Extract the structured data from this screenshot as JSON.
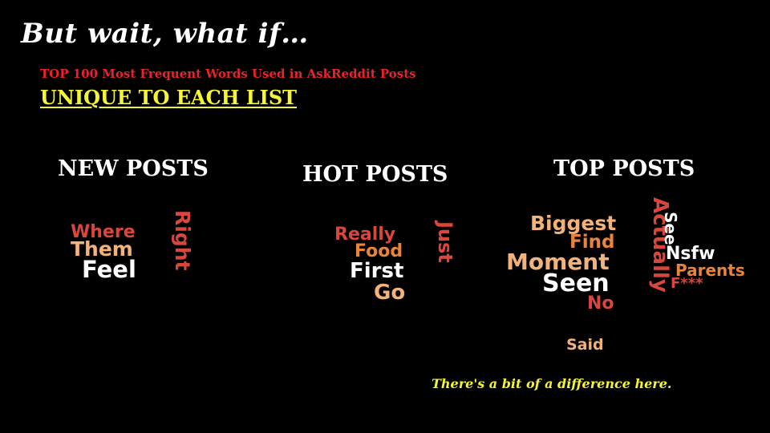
{
  "slide": {
    "title": "But wait, what if…",
    "subtitle": "TOP 100 Most Frequent Words Used in AskReddit Posts",
    "highlight": "UNIQUE TO EACH LIST",
    "caption": "There's a bit of a difference here."
  },
  "columns": {
    "new": {
      "heading": "NEW POSTS",
      "words": [
        "Where",
        "Them",
        "Feel",
        "Right"
      ]
    },
    "hot": {
      "heading": "HOT POSTS",
      "words": [
        "Really",
        "Food",
        "First",
        "Go",
        "Just"
      ]
    },
    "top": {
      "heading": "TOP POSTS",
      "words": [
        "Biggest",
        "Find",
        "Moment",
        "Seen",
        "No",
        "Actually",
        "See",
        "Nsfw",
        "Parents",
        "F***",
        "Said"
      ]
    }
  },
  "colors": {
    "background": "#000000",
    "title": "#ffffff",
    "subtitle": "#e8232b",
    "highlight": "#f5f536",
    "word_red": "#d9463b",
    "word_orange": "#e8843c",
    "word_peach": "#f2b37a",
    "word_white": "#ffffff"
  }
}
